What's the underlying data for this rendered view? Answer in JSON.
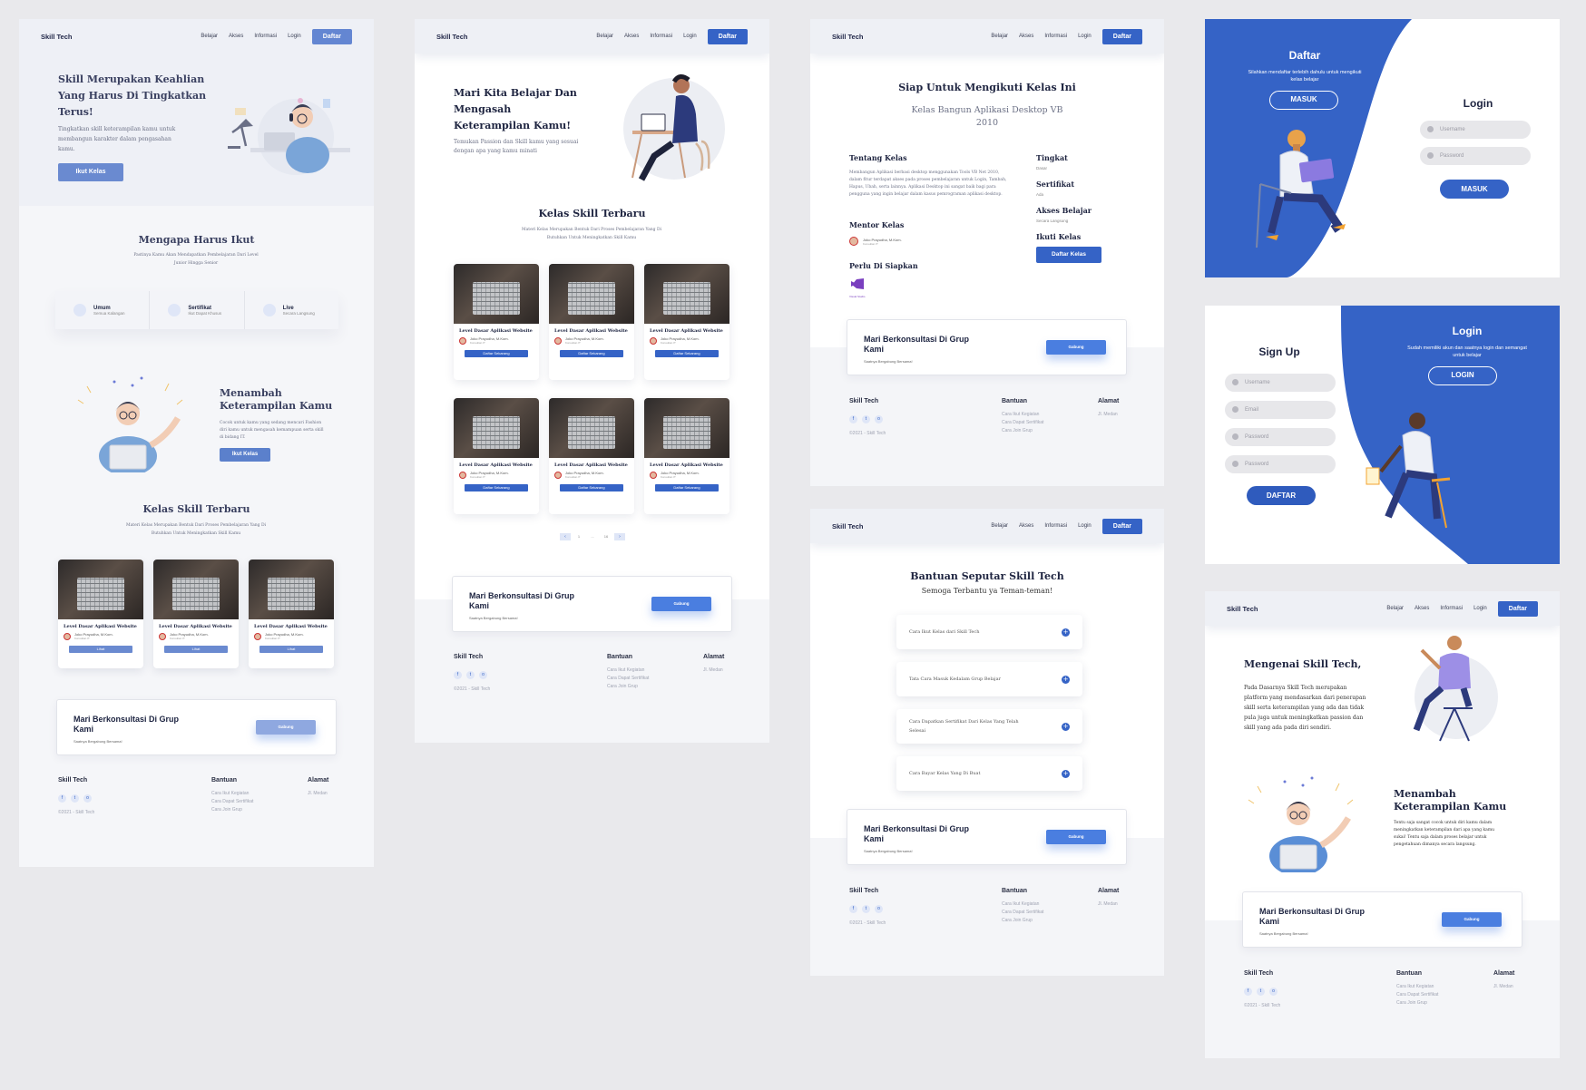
{
  "common": {
    "brand": "Skill Tech",
    "nav": [
      "Belajar",
      "Akses",
      "Informasi",
      "Login"
    ],
    "nav_cta": "Daftar",
    "consult_title": "Mari Berkonsultasi Di Grup Kami",
    "consult_sub": "Saatnya Bergabung Bersama!",
    "consult_btn": "Gabung",
    "footer": {
      "brand": "Skill Tech",
      "copyright": "©2021 - Skill Tech",
      "bantuan_title": "Bantuan",
      "bantuan_links": [
        "Cara Ikut Kegiatan",
        "Cara Dapat Sertifikat",
        "Cara Join Grup"
      ],
      "alamat_title": "Alamat",
      "alamat": "Jl. Medan"
    },
    "course_title": "Level Dasar Aplikasi Website",
    "course_mentor": "Joko Prayudha, M.Kom.",
    "course_role": "Konsultan IT"
  },
  "home": {
    "hero_title": "Skill Merupakan Keahlian Yang Harus Di Tingkatkan Terus!",
    "hero_sub": "Tingkatkan skill keterampilan kamu untuk membangun karakter dalam pengasahan kamu.",
    "hero_btn": "Ikut Kelas",
    "why_title": "Mengapa Harus Ikut",
    "why_sub": "Pastinya Kamu Akan Mendapatkan Pembelajaran Dari Level Junior Hingga Senior",
    "features": [
      {
        "title": "Umum",
        "sub": "Semua Kalangan"
      },
      {
        "title": "Sertifikat",
        "sub": "Ikut Dapat Khusus"
      },
      {
        "title": "Live",
        "sub": "Secara Langsung"
      }
    ],
    "skill_title": "Menambah Keterampilan Kamu",
    "skill_sub": "Cocok untuk kamu yang sedang mencari Fashion diri kamu untuk mengasah kemampuan serta skill di bidang IT.",
    "skill_btn": "Ikut Kelas",
    "classes_title": "Kelas Skill Terbaru",
    "classes_sub": "Materi Kelas Merupakan Bentuk Dari Proses Pembelajaran Yang Di Butuhkan Untuk Meningkatkan Skill Kamu",
    "card_btn": "Lihat"
  },
  "catalog": {
    "hero_title": "Mari Kita Belajar Dan Mengasah Keterampilan Kamu!",
    "hero_sub": "Temukan Passion dan Skill kamu yang sesuai dengan apa yang kamu minati",
    "classes_title": "Kelas Skill Terbaru",
    "classes_sub": "Materi Kelas Merupakan Bentuk Dari Proses Pembelajaran Yang Di Butuhkan Untuk Meningkatkan Skill Kamu",
    "card_btn": "Daftar Sekarang",
    "pages": [
      "‹",
      "1",
      "...",
      "16",
      "›"
    ]
  },
  "detail": {
    "title": "Siap Untuk Mengikuti Kelas Ini",
    "subtitle": "Kelas Bangun Aplikasi Desktop VB 2010",
    "about_title": "Tentang Kelas",
    "about_text": "Membangun Aplikasi berbasi desktop menggunakan Tools VB Net 2010, dalam fitur terdapat akses pada proses pembelajaran untuk Login, Tambah, Hapus, Ubah, serta lainnya. Aplikasi Desktop ini sangat baik bagi para pengguna yang ingin belajar dalam kasus pemrograman aplikasi desktop.",
    "mentor_title": "Mentor Kelas",
    "mentor_name": "Joko Prayudha, M.Kom.",
    "mentor_role": "Konsultan IT",
    "prep_title": "Perlu Di Siapkan",
    "prep_item": "Visual Studio",
    "meta": [
      {
        "k": "Tingkat",
        "v": "Dasar"
      },
      {
        "k": "Sertifikat",
        "v": "Ada"
      },
      {
        "k": "Akses Belajar",
        "v": "Secara Langsung"
      },
      {
        "k": "Ikuti Kelas",
        "v": ""
      }
    ],
    "cta": "Daftar Kelas"
  },
  "help": {
    "title": "Bantuan Seputar Skill Tech",
    "subtitle": "Semoga Terbantu ya Teman-teman!",
    "faqs": [
      "Cara Ikut Kelas dari Skill Tech",
      "Tata Cara Masuk Kedalam Grup Belajar",
      "Cara Dapatkan Sertifikat Dari Kelas Yang Telah Selesai",
      "Cara Bayar Kelas Yang Di Buat"
    ]
  },
  "auth_login": {
    "side_title": "Daftar",
    "side_sub": "Silahkan mendaftar terlebih dahulu untuk mengikuti kelas belajar",
    "side_btn": "MASUK",
    "form_title": "Login",
    "fields": [
      "Username",
      "Password"
    ],
    "submit": "MASUK"
  },
  "auth_signup": {
    "form_title": "Sign Up",
    "fields": [
      "Username",
      "Email",
      "Password",
      "Password"
    ],
    "submit": "DAFTAR",
    "side_title": "Login",
    "side_sub": "Sudah memiliki akun dan saatnya login dan semangat untuk belajar",
    "side_btn": "LOGIN"
  },
  "about": {
    "title": "Mengenai Skill Tech,",
    "text": "Pada Dasarnya Skill Tech merupakan platform yang mendasarkan dari penerapan skill serta keterampilan yang ada dan tidak pula juga untuk meningkatkan passion dan skill yang ada pada diri sendiri.",
    "skill_title": "Menambah Keterampilan Kamu",
    "skill_text": "Tentu saja sangat cocok untuk diri kamu dalam meningkatkan keterampilan dari apa yang kamu sukai! Tentu saja dalam proses belajar untuk pengetahuan dimanya secara langsung."
  },
  "colors": {
    "primary": "#3563c6",
    "dark": "#1c2340",
    "bg": "#e9e9ec"
  }
}
